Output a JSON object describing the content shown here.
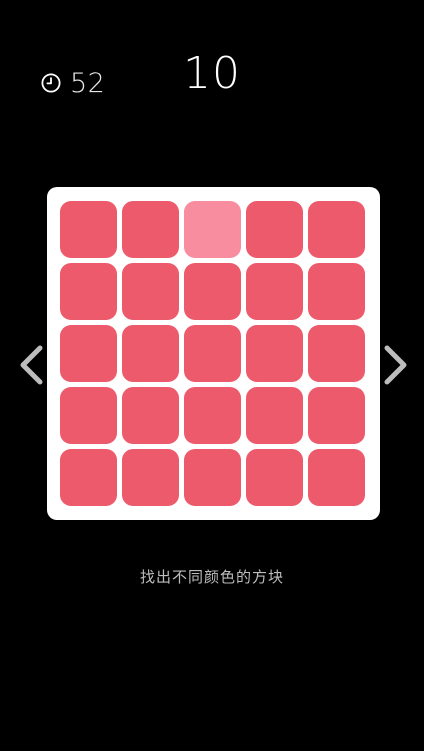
{
  "timer": {
    "icon": "clock-icon",
    "value": "52"
  },
  "score": "10",
  "board": {
    "rows": 5,
    "columns": 5,
    "base_color": "#ec5a6c",
    "odd_color": "#f78d9f",
    "board_color": "#ffffff",
    "odd_tile": {
      "row": 1,
      "column": 3
    }
  },
  "navigation": {
    "prev_icon": "chevron-left-icon",
    "next_icon": "chevron-right-icon"
  },
  "hint": "找出不同颜色的方块",
  "colors": {
    "background": "#000000",
    "text": "#ffffff",
    "hint_text": "#bdbdbd",
    "arrow": "#bdbdbd"
  }
}
